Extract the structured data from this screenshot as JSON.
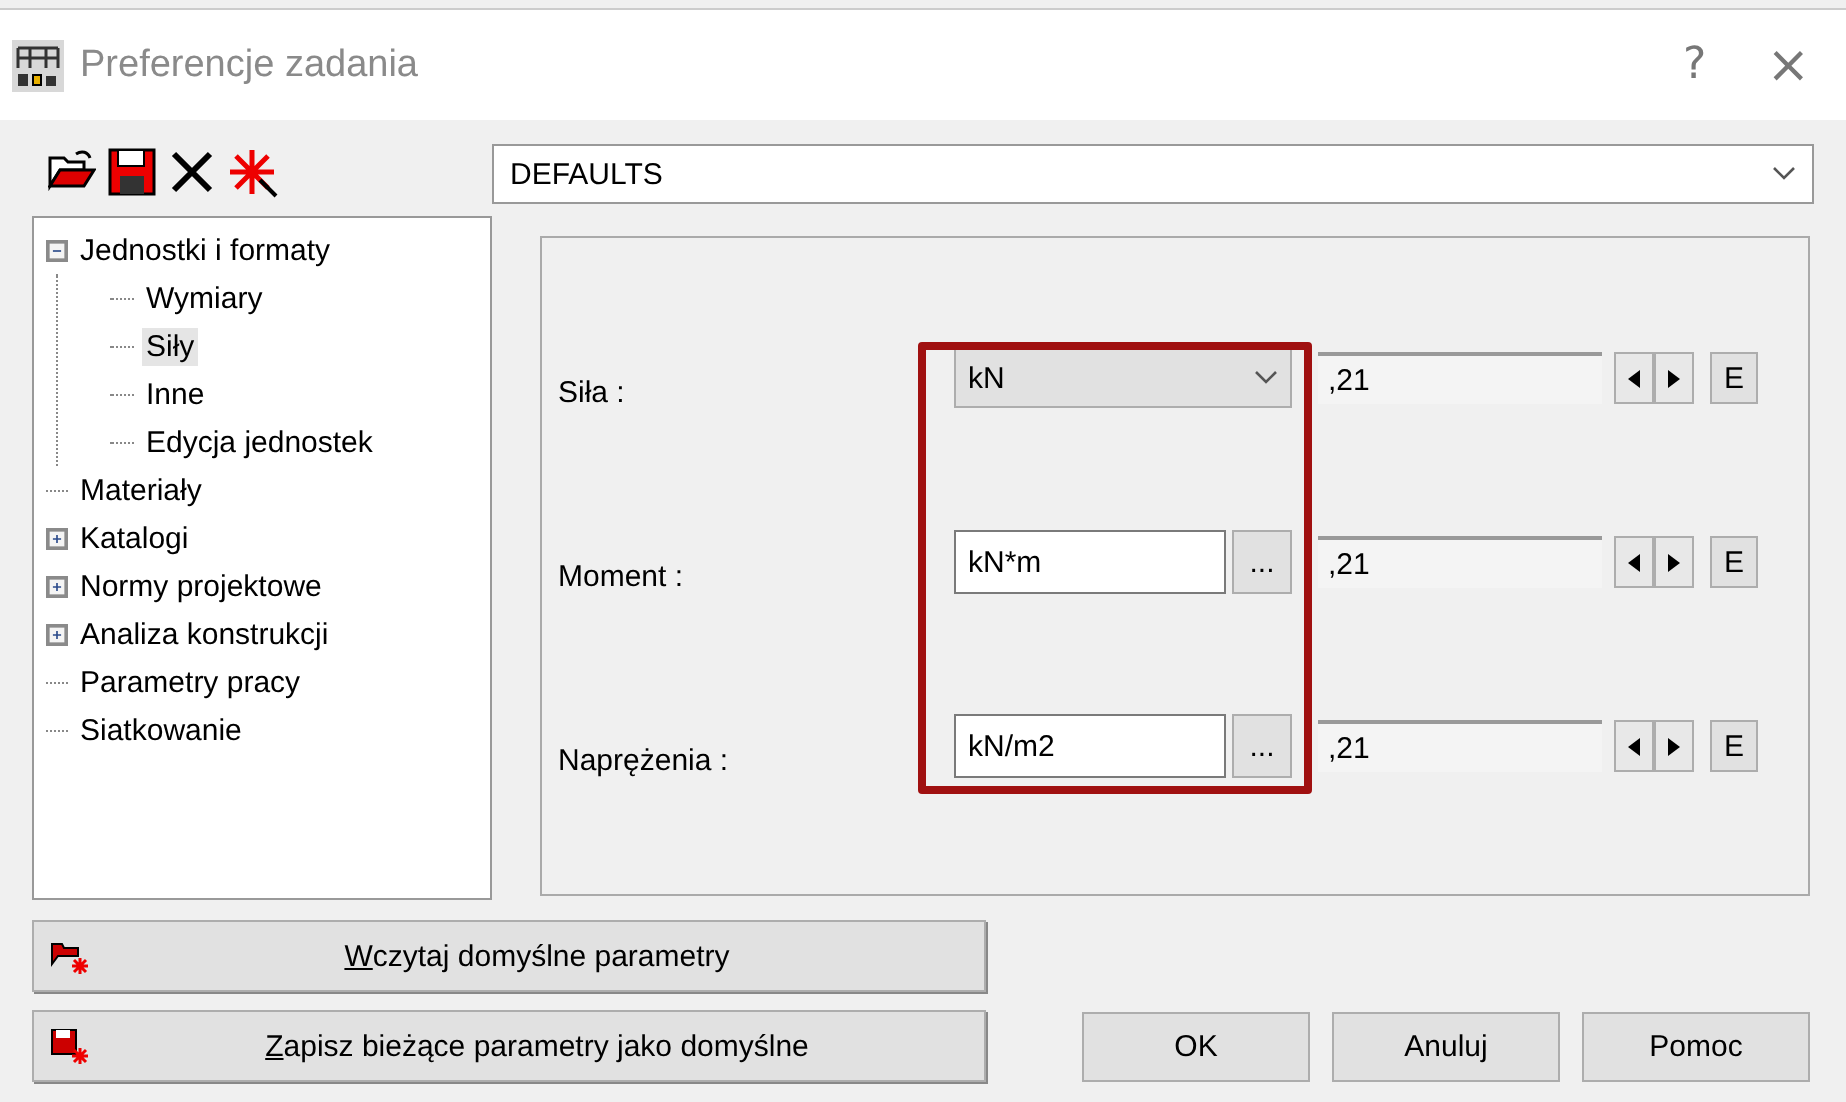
{
  "window": {
    "title": "Preferencje zadania",
    "help": "?",
    "close": "×"
  },
  "toolbar": {
    "preset": "DEFAULTS"
  },
  "tree": [
    {
      "label": "Jednostki i formaty",
      "expanded": true,
      "selected": false,
      "children": [
        {
          "label": "Wymiary",
          "selected": false
        },
        {
          "label": "Siły",
          "selected": true
        },
        {
          "label": "Inne",
          "selected": false
        },
        {
          "label": "Edycja jednostek",
          "selected": false
        }
      ]
    },
    {
      "label": "Materiały",
      "selected": false
    },
    {
      "label": "Katalogi",
      "expanded": false,
      "selected": false
    },
    {
      "label": "Normy projektowe",
      "expanded": false,
      "selected": false
    },
    {
      "label": "Analiza konstrukcji",
      "expanded": false,
      "selected": false
    },
    {
      "label": "Parametry pracy",
      "selected": false
    },
    {
      "label": "Siatkowanie",
      "selected": false
    }
  ],
  "units_highlighted": true,
  "rows": [
    {
      "label": "Siła :",
      "kind": "dropdown",
      "unit": "kN",
      "value": ",21",
      "edit": "E"
    },
    {
      "label": "Moment :",
      "kind": "picker",
      "unit": "kN*m",
      "value": ",21",
      "more": "...",
      "edit": "E"
    },
    {
      "label": "Naprężenia :",
      "kind": "picker",
      "unit": "kN/m2",
      "value": ",21",
      "more": "...",
      "edit": "E"
    }
  ],
  "actions": [
    {
      "label": "Wczytaj domyślne parametry",
      "kind": "load"
    },
    {
      "label": "Zapisz bieżące parametry jako domyślne",
      "kind": "save"
    }
  ],
  "buttons": [
    "OK",
    "Anuluj",
    "Pomoc"
  ]
}
